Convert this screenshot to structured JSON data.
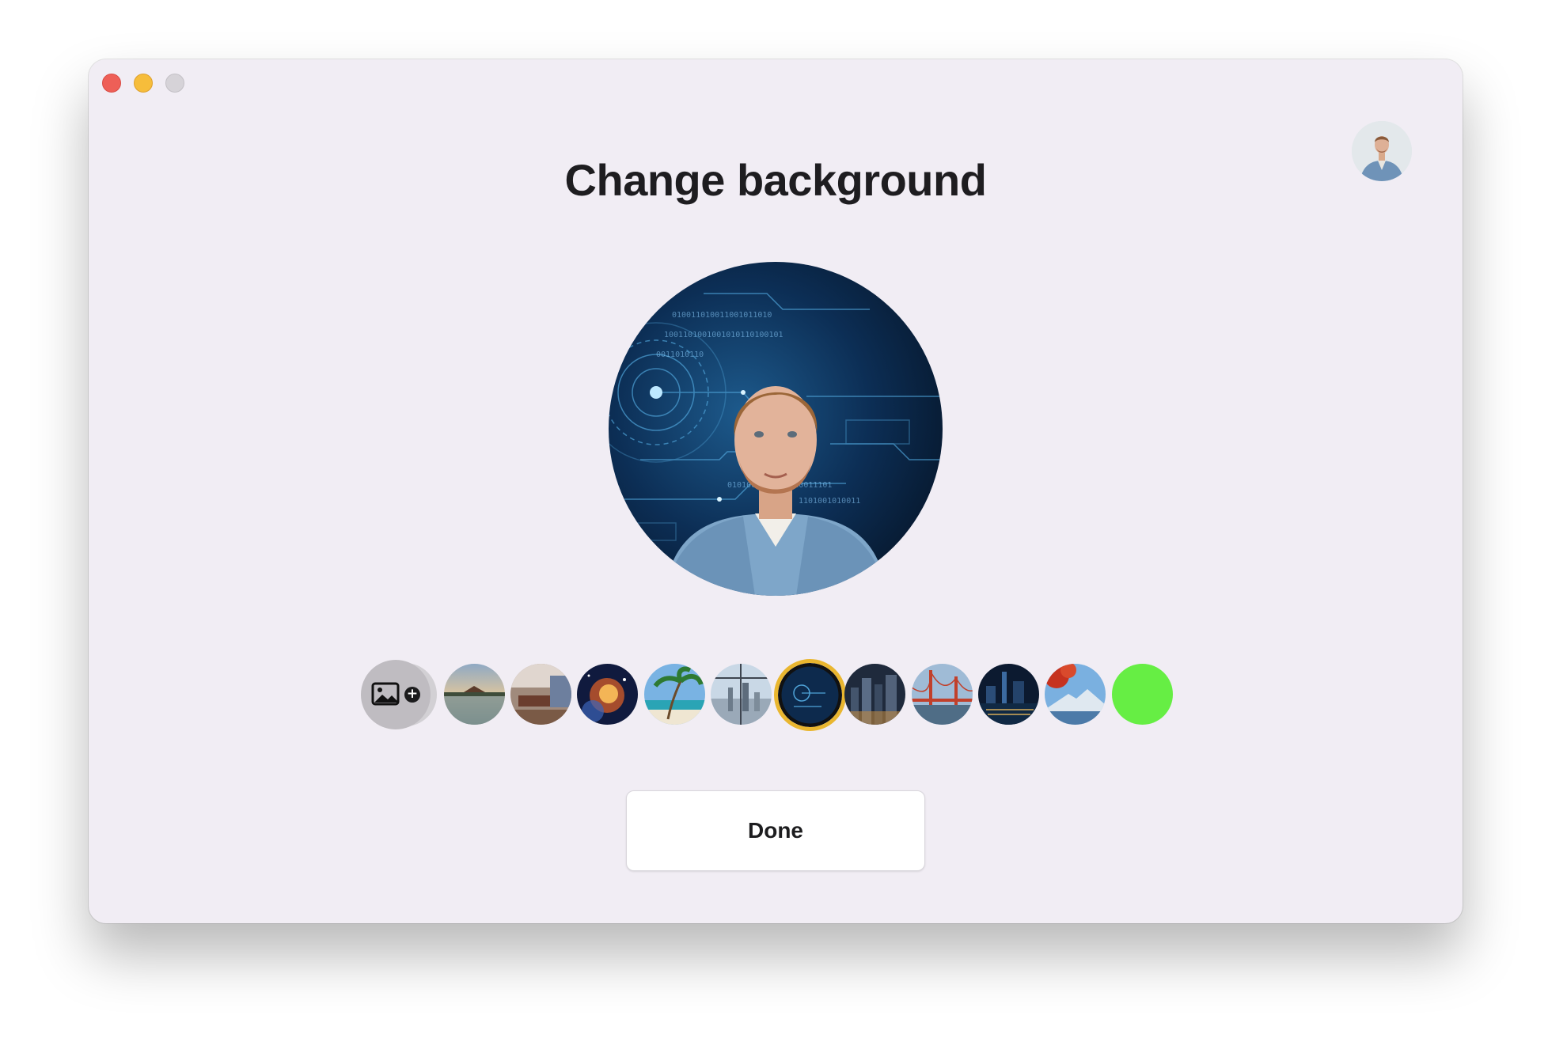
{
  "window": {
    "controls": [
      "close",
      "minimize",
      "maximize"
    ]
  },
  "header": {
    "title": "Change background",
    "avatar_icon": "user-avatar"
  },
  "preview": {
    "selected_background": "tech-circuit",
    "subject": "person-portrait"
  },
  "backgrounds": {
    "add_button_icon": "add-image-icon",
    "items": [
      {
        "id": "palace-lake",
        "icon": "palace-lake-thumbnail"
      },
      {
        "id": "modern-interior",
        "icon": "interior-thumbnail"
      },
      {
        "id": "space-nebula",
        "icon": "space-thumbnail"
      },
      {
        "id": "tropical-beach",
        "icon": "beach-thumbnail"
      },
      {
        "id": "city-window",
        "icon": "city-window-thumbnail"
      },
      {
        "id": "tech-circuit",
        "icon": "tech-thumbnail",
        "selected": true
      },
      {
        "id": "city-night",
        "icon": "city-night-thumbnail"
      },
      {
        "id": "golden-gate",
        "icon": "bridge-thumbnail"
      },
      {
        "id": "night-skyline",
        "icon": "skyline-thumbnail"
      },
      {
        "id": "mountain-autumn",
        "icon": "mountain-thumbnail"
      },
      {
        "id": "green-screen",
        "icon": "green-screen-thumbnail"
      }
    ],
    "selected_color": "#e9b62f",
    "green_screen_color": "#66ee44"
  },
  "actions": {
    "done_label": "Done"
  }
}
